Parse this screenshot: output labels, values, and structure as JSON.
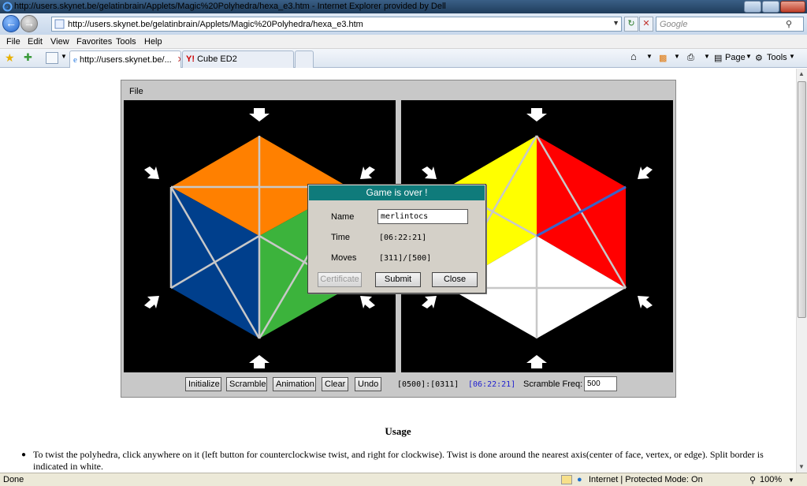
{
  "window": {
    "title": "http://users.skynet.be/gelatinbrain/Applets/Magic%20Polyhedra/hexa_e3.htm - Internet Explorer provided by Dell"
  },
  "address_bar": {
    "url": "http://users.skynet.be/gelatinbrain/Applets/Magic%20Polyhedra/hexa_e3.htm",
    "search_placeholder": "Google"
  },
  "menu": {
    "items": [
      "File",
      "Edit",
      "View",
      "Favorites",
      "Tools",
      "Help"
    ]
  },
  "tabs": [
    {
      "label": "http://users.skynet.be/..."
    },
    {
      "label": "Cube ED2"
    }
  ],
  "command_bar": {
    "page_label": "Page",
    "tools_label": "Tools"
  },
  "applet": {
    "menu_file": "File",
    "buttons": {
      "initialize": "Initialize",
      "scramble": "Scramble",
      "animation": "Animation",
      "clear": "Clear",
      "undo": "Undo"
    },
    "counter": "[0500]:[0311]",
    "timer": "[06:22:21]",
    "scramble_freq_label": "Scramble Freq:",
    "scramble_freq_value": "500",
    "colors": {
      "orange": "#ff8000",
      "blue": "#003f8c",
      "green": "#3cb33c",
      "yellow": "#ffff00",
      "red": "#ff0000",
      "white": "#ffffff",
      "timer": "#2020d0"
    }
  },
  "dialog": {
    "title": "Game is over !",
    "name_label": "Name",
    "name_value": "merlintocs",
    "time_label": "Time",
    "time_value": "[06:22:21]",
    "moves_label": "Moves",
    "moves_value": "[311]/[500]",
    "certificate_label": "Certificate",
    "submit_label": "Submit",
    "close_label": "Close"
  },
  "usage": {
    "title": "Usage",
    "items": [
      "To twist the polyhedra, click anywhere on it (left button for counterclockwise twist, and right for clockwise). Twist is done around the nearest axis(center of face, vertex, or edge). Split border is indicated in white."
    ]
  },
  "status": {
    "left": "Done",
    "zone": "Internet | Protected Mode: On",
    "zoom": "100%"
  }
}
